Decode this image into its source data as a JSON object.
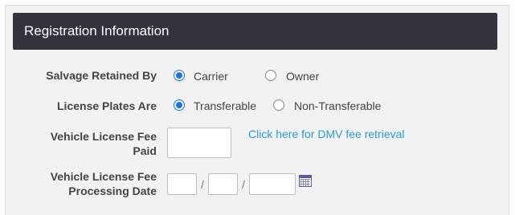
{
  "section": {
    "title": "Registration Information"
  },
  "salvage": {
    "label": "Salvage Retained By",
    "options": [
      {
        "label": "Carrier",
        "selected": true
      },
      {
        "label": "Owner",
        "selected": false
      }
    ]
  },
  "plates": {
    "label": "License Plates Are",
    "options": [
      {
        "label": "Transferable",
        "selected": true
      },
      {
        "label": "Non-Transferable",
        "selected": false
      }
    ]
  },
  "fee_paid": {
    "label_line1": "Vehicle License Fee",
    "label_line2": "Paid",
    "value": "",
    "link_text": "Click here for DMV fee retrieval"
  },
  "processing_date": {
    "label_line1": "Vehicle License Fee",
    "label_line2": "Processing Date",
    "month": "",
    "day": "",
    "year": "",
    "separator": "/",
    "icon": "calendar-icon"
  },
  "colors": {
    "header_bg": "#33333d",
    "panel_bg": "#f2f2f2",
    "radio_accent": "#1a73e8",
    "link": "#2a9ad6"
  }
}
